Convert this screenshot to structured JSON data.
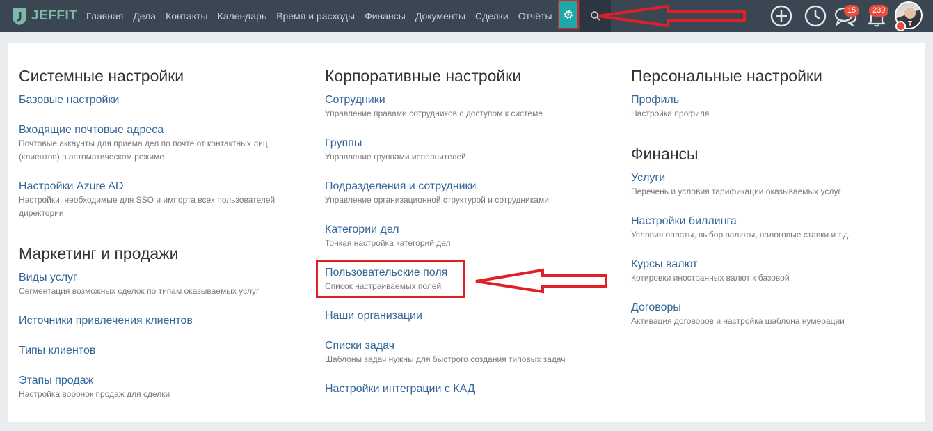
{
  "app": {
    "logo_text": "JEFFIT"
  },
  "nav": {
    "items": [
      "Главная",
      "Дела",
      "Контакты",
      "Календарь",
      "Время и расходы",
      "Финансы",
      "Документы",
      "Сделки",
      "Отчёты"
    ]
  },
  "header_actions": {
    "chat_badge": "15",
    "notifications_badge": "239"
  },
  "colors": {
    "topbar": "#3b4653",
    "accent": "#1fa8a8",
    "link": "#336699",
    "annotation": "#e01f26"
  },
  "columns": [
    {
      "sections": [
        {
          "title": "Системные настройки",
          "items": [
            {
              "label": "Базовые настройки",
              "desc": ""
            },
            {
              "label": "Входящие почтовые адреса",
              "desc": "Почтовые аккаунты для приема дел по почте от контактных лиц (клиентов) в автоматическом режиме"
            },
            {
              "label": "Настройки Azure AD",
              "desc": "Настройки, необходимые для SSO и импорта всех пользователей директории"
            }
          ]
        },
        {
          "title": "Маркетинг и продажи",
          "items": [
            {
              "label": "Виды услуг",
              "desc": "Сегментация возможных сделок по типам оказываемых услуг"
            },
            {
              "label": "Источники привлечения клиентов",
              "desc": ""
            },
            {
              "label": "Типы клиентов",
              "desc": ""
            },
            {
              "label": "Этапы продаж",
              "desc": "Настройка воронок продаж для сделки"
            }
          ]
        }
      ]
    },
    {
      "sections": [
        {
          "title": "Корпоративные настройки",
          "items": [
            {
              "label": "Сотрудники",
              "desc": "Управление правами сотрудников с доступом к системе"
            },
            {
              "label": "Группы",
              "desc": "Управление группами исполнителей"
            },
            {
              "label": "Подразделения и сотрудники",
              "desc": "Управление организационной структурой и сотрудниками"
            },
            {
              "label": "Категории дел",
              "desc": "Тонкая настройка категорий дел"
            },
            {
              "label": "Пользовательские поля",
              "desc": "Список настраиваемых полей"
            },
            {
              "label": "Наши организации",
              "desc": ""
            },
            {
              "label": "Списки задач",
              "desc": "Шаблоны задач нужны для быстрого создания типовых задач"
            },
            {
              "label": "Настройки интеграции с КАД",
              "desc": ""
            }
          ]
        }
      ]
    },
    {
      "sections": [
        {
          "title": "Персональные настройки",
          "items": [
            {
              "label": "Профиль",
              "desc": "Настройка профиля"
            }
          ]
        },
        {
          "title": "Финансы",
          "items": [
            {
              "label": "Услуги",
              "desc": "Перечень и условия тарификации оказываемых услуг"
            },
            {
              "label": "Настройки биллинга",
              "desc": "Условия оплаты, выбор валюты, налоговые ставки и т.д."
            },
            {
              "label": "Курсы валют",
              "desc": "Котировки иностранных валют к базовой"
            },
            {
              "label": "Договоры",
              "desc": "Активация договоров и настройка шаблона нумерации"
            }
          ]
        }
      ]
    }
  ]
}
